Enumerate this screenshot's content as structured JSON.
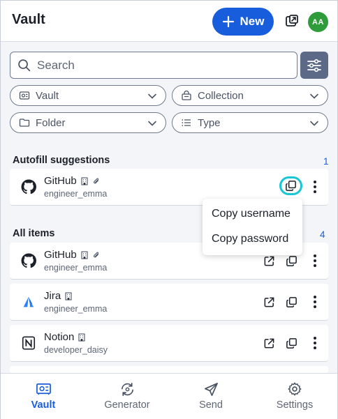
{
  "header": {
    "title": "Vault",
    "new_label": "New",
    "avatar_initials": "AA",
    "accent": "#175ddc",
    "avatar_color": "#2e9c3a"
  },
  "search": {
    "placeholder": "Search",
    "value": ""
  },
  "filters": {
    "vault": "Vault",
    "collection": "Collection",
    "folder": "Folder",
    "type": "Type"
  },
  "autofill": {
    "title": "Autofill suggestions",
    "count": "1",
    "items": [
      {
        "name": "GitHub",
        "username": "engineer_emma",
        "icon": "github-icon"
      }
    ]
  },
  "copy_menu": {
    "items": [
      "Copy username",
      "Copy password"
    ]
  },
  "all_items": {
    "title": "All items",
    "count": "4",
    "items": [
      {
        "name": "GitHub",
        "username": "engineer_emma",
        "icon": "github-icon"
      },
      {
        "name": "Jira",
        "username": "engineer_emma",
        "icon": "jira-icon"
      },
      {
        "name": "Notion",
        "username": "developer_daisy",
        "icon": "notion-icon"
      }
    ]
  },
  "nav": {
    "items": [
      {
        "label": "Vault",
        "icon": "vault-icon",
        "active": true
      },
      {
        "label": "Generator",
        "icon": "generator-icon",
        "active": false
      },
      {
        "label": "Send",
        "icon": "send-icon",
        "active": false
      },
      {
        "label": "Settings",
        "icon": "settings-icon",
        "active": false
      }
    ]
  }
}
